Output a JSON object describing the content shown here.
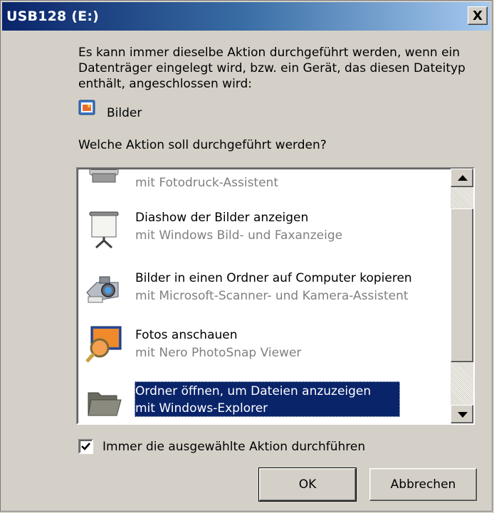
{
  "window": {
    "title": "USB128 (E:)",
    "close_symbol": "X"
  },
  "description": "Es kann immer dieselbe Aktion durchgeführt werden, wenn ein Datenträger eingelegt wird, bzw. ein Gerät, das diesen Dateityp enthält, angeschlossen wird:",
  "content_type": {
    "icon": "pictures-icon",
    "label": "Bilder"
  },
  "question": "Welche Aktion soll durchgeführt werden?",
  "actions": [
    {
      "title": "",
      "subtitle": "mit Fotodruck-Assistent",
      "icon": "printer-icon",
      "selected": false
    },
    {
      "title": "Diashow der Bilder anzeigen",
      "subtitle": "mit Windows Bild- und Faxanzeige",
      "icon": "projector-screen-icon",
      "selected": false
    },
    {
      "title": "Bilder in einen Ordner auf Computer kopieren",
      "subtitle": "mit Microsoft-Scanner- und Kamera-Assistent",
      "icon": "camera-icon",
      "selected": false
    },
    {
      "title": "Fotos anschauen",
      "subtitle": "mit Nero PhotoSnap Viewer",
      "icon": "photo-magnifier-icon",
      "selected": false
    },
    {
      "title": "Ordner öffnen, um Dateien anzuzeigen",
      "subtitle": "mit Windows-Explorer",
      "icon": "folder-icon",
      "selected": true
    }
  ],
  "always_checkbox": {
    "label": "Immer die ausgewählte Aktion durchführen",
    "checked": true
  },
  "buttons": {
    "ok": "OK",
    "cancel": "Abbrechen"
  }
}
